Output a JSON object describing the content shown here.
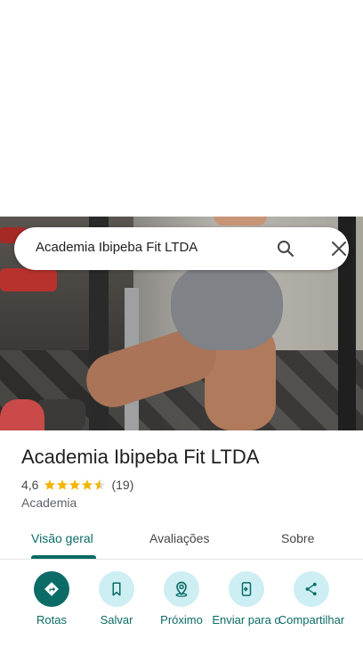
{
  "search": {
    "query": "Academia Ibipeba Fit LTDA"
  },
  "place": {
    "name": "Academia Ibipeba Fit LTDA",
    "rating": "4,6",
    "rating_value": 4.6,
    "review_count": "(19)",
    "category": "Academia"
  },
  "tabs": [
    {
      "label": "Visão geral",
      "active": true
    },
    {
      "label": "Avaliações",
      "active": false
    },
    {
      "label": "Sobre",
      "active": false
    }
  ],
  "actions": [
    {
      "label": "Rotas",
      "icon": "directions-icon"
    },
    {
      "label": "Salvar",
      "icon": "bookmark-icon"
    },
    {
      "label": "Próximo",
      "icon": "nearby-icon"
    },
    {
      "label": "Enviar para o",
      "icon": "send-to-phone-icon"
    },
    {
      "label": "Compartilhar",
      "icon": "share-icon"
    }
  ],
  "colors": {
    "accent": "#0b6b66",
    "action_bg": "#cdeef3",
    "star": "#f4b400"
  }
}
